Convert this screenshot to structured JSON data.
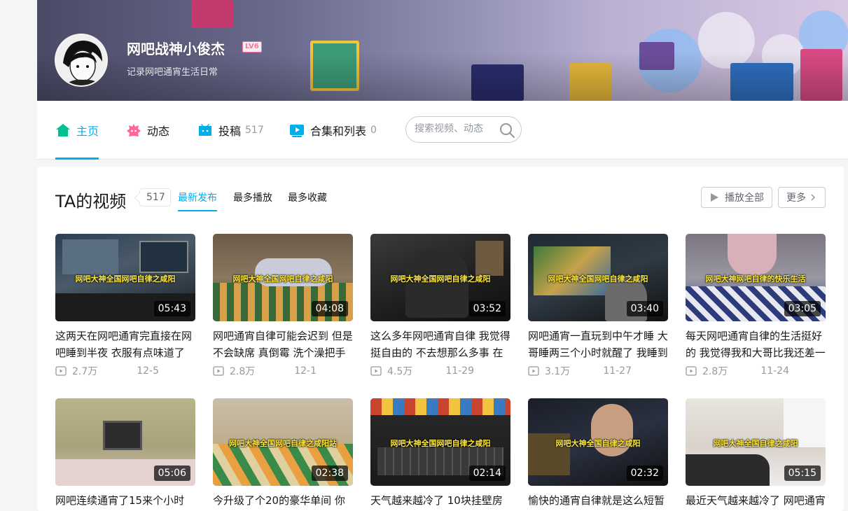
{
  "profile": {
    "username": "网吧战神小俊杰",
    "level": "LV6",
    "signature": "记录网吧通宵生活日常"
  },
  "nav": {
    "home": "主页",
    "dynamic": "动态",
    "uploads": "投稿",
    "uploads_count": "517",
    "collections": "合集和列表",
    "collections_count": "0",
    "search_placeholder": "搜索视频、动态"
  },
  "section": {
    "title": "TA的视频",
    "count": "517",
    "sort_latest": "最新发布",
    "sort_most_played": "最多播放",
    "sort_most_favorited": "最多收藏",
    "play_all": "播放全部",
    "more": "更多"
  },
  "videos": [
    {
      "title": "这两天在网吧通宵完直接在网吧睡到半夜 衣服有点味道了",
      "duration": "05:43",
      "views": "2.7万",
      "date": "12-5",
      "caption": "网吧大神全国网吧自律之咸阳"
    },
    {
      "title": "网吧通宵自律可能会迟到 但是不会缺席 真倒霉 洗个澡把手",
      "duration": "04:08",
      "views": "2.8万",
      "date": "12-1",
      "caption": "网吧大神全国网吧自律之咸阳"
    },
    {
      "title": "这么多年网吧通宵自律 我觉得挺自由的 不去想那么多事 在",
      "duration": "03:52",
      "views": "4.5万",
      "date": "11-29",
      "caption": "网吧大神全国网吧自律之咸阳"
    },
    {
      "title": "网吧通宵一直玩到中午才睡 大哥睡两三个小时就醒了 我睡到",
      "duration": "03:40",
      "views": "3.1万",
      "date": "11-27",
      "caption": "网吧大神全国网吧自律之咸阳"
    },
    {
      "title": "每天网吧通宵自律的生活挺好的 我觉得我和大哥比我还差一",
      "duration": "03:05",
      "views": "2.8万",
      "date": "11-24",
      "caption": "网吧大神网吧自律的快乐生活"
    },
    {
      "title": "网吧连续通宵了15来个小时",
      "duration": "05:06",
      "views": "",
      "date": "",
      "caption": ""
    },
    {
      "title": "今升级了个20的豪华单间 你",
      "duration": "02:38",
      "views": "",
      "date": "",
      "caption": "网吧大神全国网吧自律之咸阳站"
    },
    {
      "title": "天气越来越冷了 10块挂壁房",
      "duration": "02:14",
      "views": "",
      "date": "",
      "caption": "网吧大神全国网吧自律之咸阳"
    },
    {
      "title": "愉快的通宵自律就是这么短暂",
      "duration": "02:32",
      "views": "",
      "date": "",
      "caption": "网吧大神全国自律之咸阳"
    },
    {
      "title": "最近天气越来越冷了 网吧通宵",
      "duration": "05:15",
      "views": "",
      "date": "",
      "caption": "网吧大神全国自律之咸阳"
    }
  ]
}
